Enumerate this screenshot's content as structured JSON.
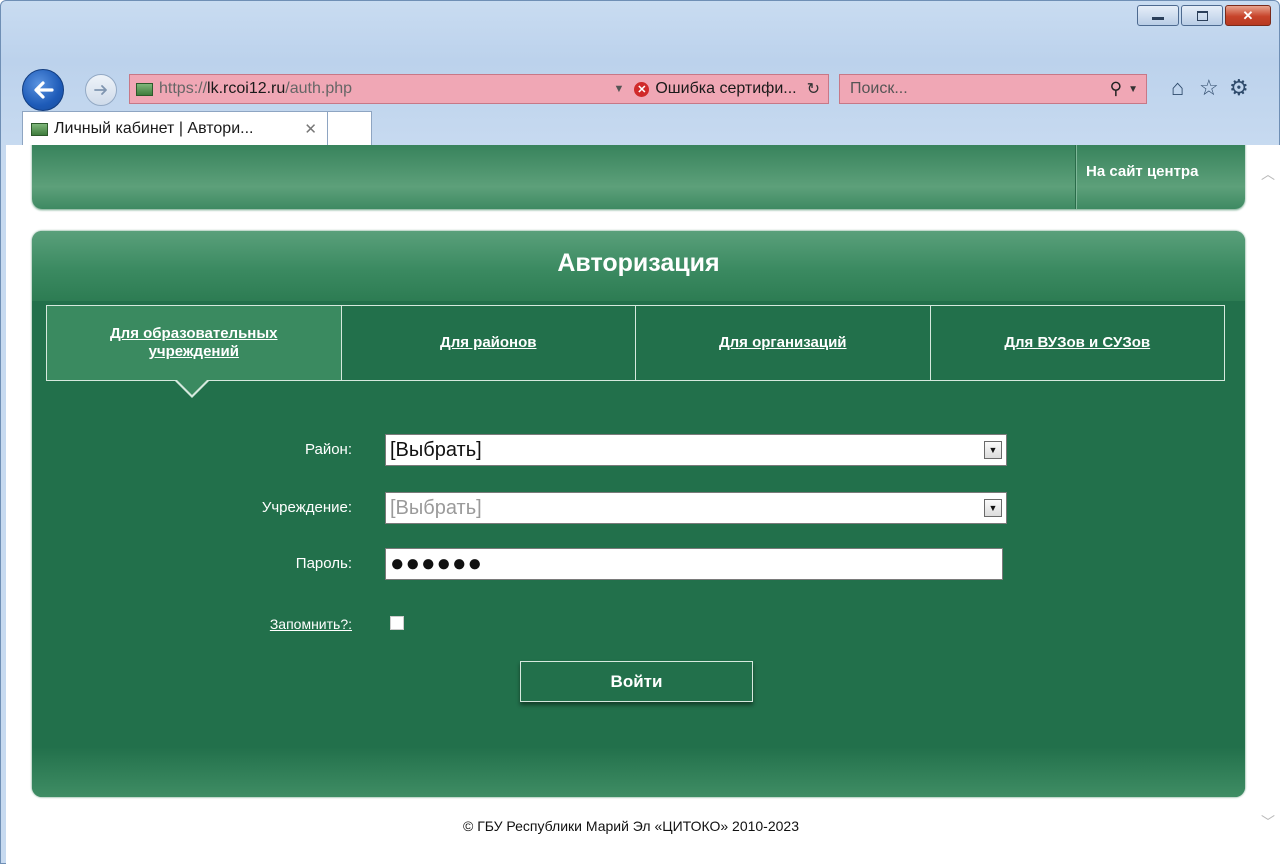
{
  "browser": {
    "address": {
      "protocol": "https://",
      "host": "lk.rcoi12.ru",
      "path": "/auth.php"
    },
    "cert_error": "Ошибка сертифи...",
    "search_placeholder": "Поиск...",
    "tab_title": "Личный кабинет | Автори...",
    "icons": [
      "back-icon",
      "forward-icon",
      "refresh-icon",
      "search-icon",
      "home-icon",
      "star-icon",
      "gear-icon",
      "minimize-icon",
      "maximize-icon",
      "close-icon"
    ]
  },
  "top_nav": {
    "site_link": "На сайт центра"
  },
  "panel": {
    "title": "Авторизация",
    "tabs": [
      {
        "line1": "Для образовательных",
        "line2": "учреждений"
      },
      {
        "line1": "Для районов",
        "line2": ""
      },
      {
        "line1": "Для организаций",
        "line2": ""
      },
      {
        "line1": "Для ВУЗов и СУЗов",
        "line2": ""
      }
    ]
  },
  "form": {
    "district_label": "Район:",
    "district_value": "[Выбрать]",
    "institution_label": "Учреждение:",
    "institution_value": "[Выбрать]",
    "password_label": "Пароль:",
    "password_value": "●●●●●●",
    "remember_label": "Запомнить?:",
    "remember_checked": false,
    "submit_label": "Войти"
  },
  "footer": {
    "copyright": "© ГБУ Республики Марий Эл «ЦИТОКО» 2010-2023"
  },
  "colors": {
    "panel_green": "#22704b",
    "address_bar_error": "#f0a7b5"
  }
}
